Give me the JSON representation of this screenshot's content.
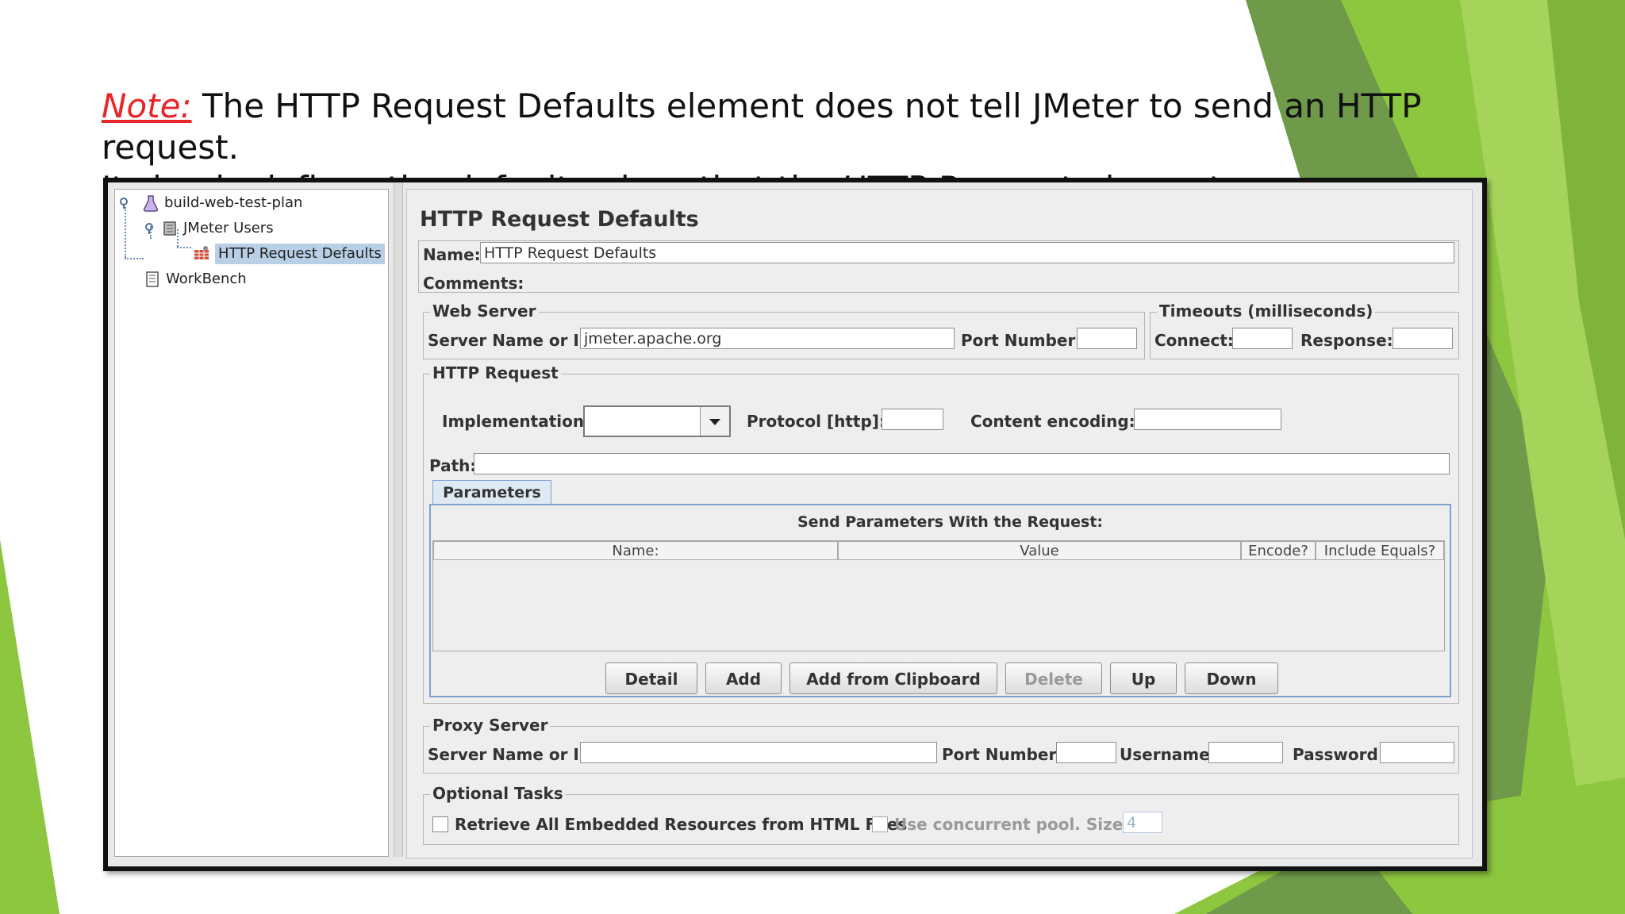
{
  "slide": {
    "note_label": "Note:",
    "note_text": " The HTTP Request Defaults element does not tell JMeter to send an HTTP request.",
    "note_line2": "It simply defines the default values that the HTTP Request elements use."
  },
  "tree": {
    "items": [
      {
        "label": "build-web-test-plan",
        "icon": "flask-icon"
      },
      {
        "label": "JMeter Users",
        "icon": "thread-group-icon"
      },
      {
        "label": "HTTP Request Defaults",
        "icon": "config-element-icon"
      },
      {
        "label": "WorkBench",
        "icon": "workbench-icon"
      }
    ]
  },
  "panel": {
    "title": "HTTP Request Defaults",
    "name_label": "Name:",
    "name_value": "HTTP Request Defaults",
    "comments_label": "Comments:",
    "web_server": {
      "title": "Web Server",
      "server_label": "Server Name or IP:",
      "server_value": "jmeter.apache.org",
      "port_label": "Port Number:"
    },
    "timeouts": {
      "title": "Timeouts (milliseconds)",
      "connect_label": "Connect:",
      "response_label": "Response:"
    },
    "http_request": {
      "title": "HTTP Request",
      "impl_label": "Implementation:",
      "protocol_label": "Protocol [http]:",
      "encoding_label": "Content encoding:",
      "path_label": "Path:"
    },
    "parameters": {
      "tab_label": "Parameters",
      "heading": "Send Parameters With the Request:",
      "columns": [
        "Name:",
        "Value",
        "Encode?",
        "Include Equals?"
      ],
      "buttons": [
        "Detail",
        "Add",
        "Add from Clipboard",
        "Delete",
        "Up",
        "Down"
      ]
    },
    "proxy": {
      "title": "Proxy Server",
      "server_label": "Server Name or IP:",
      "port_label": "Port Number:",
      "username_label": "Username",
      "password_label": "Password"
    },
    "optional": {
      "title": "Optional Tasks",
      "retrieve_label": "Retrieve All Embedded Resources from HTML Files",
      "concurrent_label": "Use concurrent pool. Size:",
      "pool_size": "4"
    }
  },
  "colors": {
    "note": "#e8262a",
    "green_light": "#8dc63f",
    "green_dark": "#5f8f3a",
    "tab_border": "#7da2ce"
  }
}
